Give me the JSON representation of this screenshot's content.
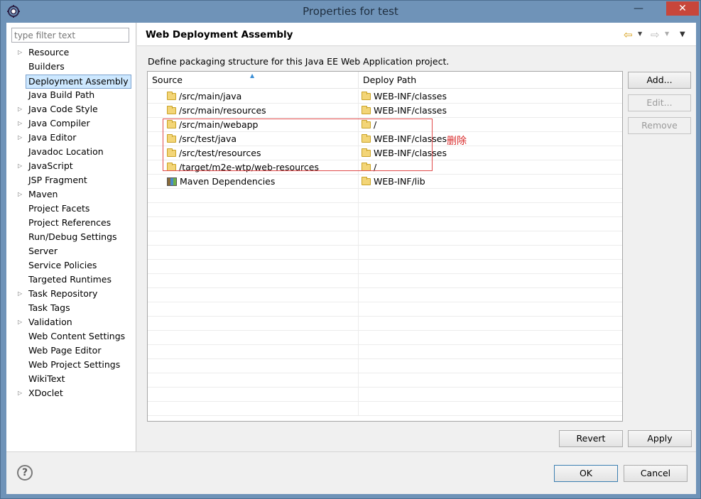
{
  "window": {
    "title": "Properties for test",
    "minimize_glyph": "—",
    "close_glyph": "✕"
  },
  "left": {
    "filter_placeholder": "type filter text",
    "tree": [
      {
        "label": "Resource",
        "expandable": true
      },
      {
        "label": "Builders",
        "expandable": false
      },
      {
        "label": "Deployment Assembly",
        "expandable": false,
        "selected": true
      },
      {
        "label": "Java Build Path",
        "expandable": false
      },
      {
        "label": "Java Code Style",
        "expandable": true
      },
      {
        "label": "Java Compiler",
        "expandable": true
      },
      {
        "label": "Java Editor",
        "expandable": true
      },
      {
        "label": "Javadoc Location",
        "expandable": false
      },
      {
        "label": "JavaScript",
        "expandable": true
      },
      {
        "label": "JSP Fragment",
        "expandable": false
      },
      {
        "label": "Maven",
        "expandable": true
      },
      {
        "label": "Project Facets",
        "expandable": false
      },
      {
        "label": "Project References",
        "expandable": false
      },
      {
        "label": "Run/Debug Settings",
        "expandable": false
      },
      {
        "label": "Server",
        "expandable": false
      },
      {
        "label": "Service Policies",
        "expandable": false
      },
      {
        "label": "Targeted Runtimes",
        "expandable": false
      },
      {
        "label": "Task Repository",
        "expandable": true
      },
      {
        "label": "Task Tags",
        "expandable": false
      },
      {
        "label": "Validation",
        "expandable": true
      },
      {
        "label": "Web Content Settings",
        "expandable": false
      },
      {
        "label": "Web Page Editor",
        "expandable": false
      },
      {
        "label": "Web Project Settings",
        "expandable": false
      },
      {
        "label": "WikiText",
        "expandable": false
      },
      {
        "label": "XDoclet",
        "expandable": true
      }
    ]
  },
  "page": {
    "title": "Web Deployment Assembly",
    "description": "Define packaging structure for this Java EE Web Application project.",
    "table": {
      "headers": {
        "source": "Source",
        "deploy": "Deploy Path"
      },
      "rows": [
        {
          "source": "/src/main/java",
          "deploy": "WEB-INF/classes",
          "icon": "folder-icon"
        },
        {
          "source": "/src/main/resources",
          "deploy": "WEB-INF/classes",
          "icon": "folder-icon"
        },
        {
          "source": "/src/main/webapp",
          "deploy": "/",
          "icon": "folder-icon"
        },
        {
          "source": "/src/test/java",
          "deploy": "WEB-INF/classes",
          "icon": "folder-icon"
        },
        {
          "source": "/src/test/resources",
          "deploy": "WEB-INF/classes",
          "icon": "folder-icon"
        },
        {
          "source": "/target/m2e-wtp/web-resources",
          "deploy": "/",
          "icon": "folder-icon"
        },
        {
          "source": "Maven Dependencies",
          "deploy": "WEB-INF/lib",
          "icon": "library-icon"
        }
      ],
      "empty_rows": 16
    },
    "annotation": "删除",
    "buttons": {
      "add": "Add...",
      "edit": "Edit...",
      "remove": "Remove",
      "revert": "Revert",
      "apply": "Apply"
    }
  },
  "footer": {
    "help_glyph": "?",
    "ok": "OK",
    "cancel": "Cancel"
  },
  "colors": {
    "accent": "#3c7fb1",
    "highlight_box": "#e04a4a",
    "selection": "#cde8ff"
  }
}
